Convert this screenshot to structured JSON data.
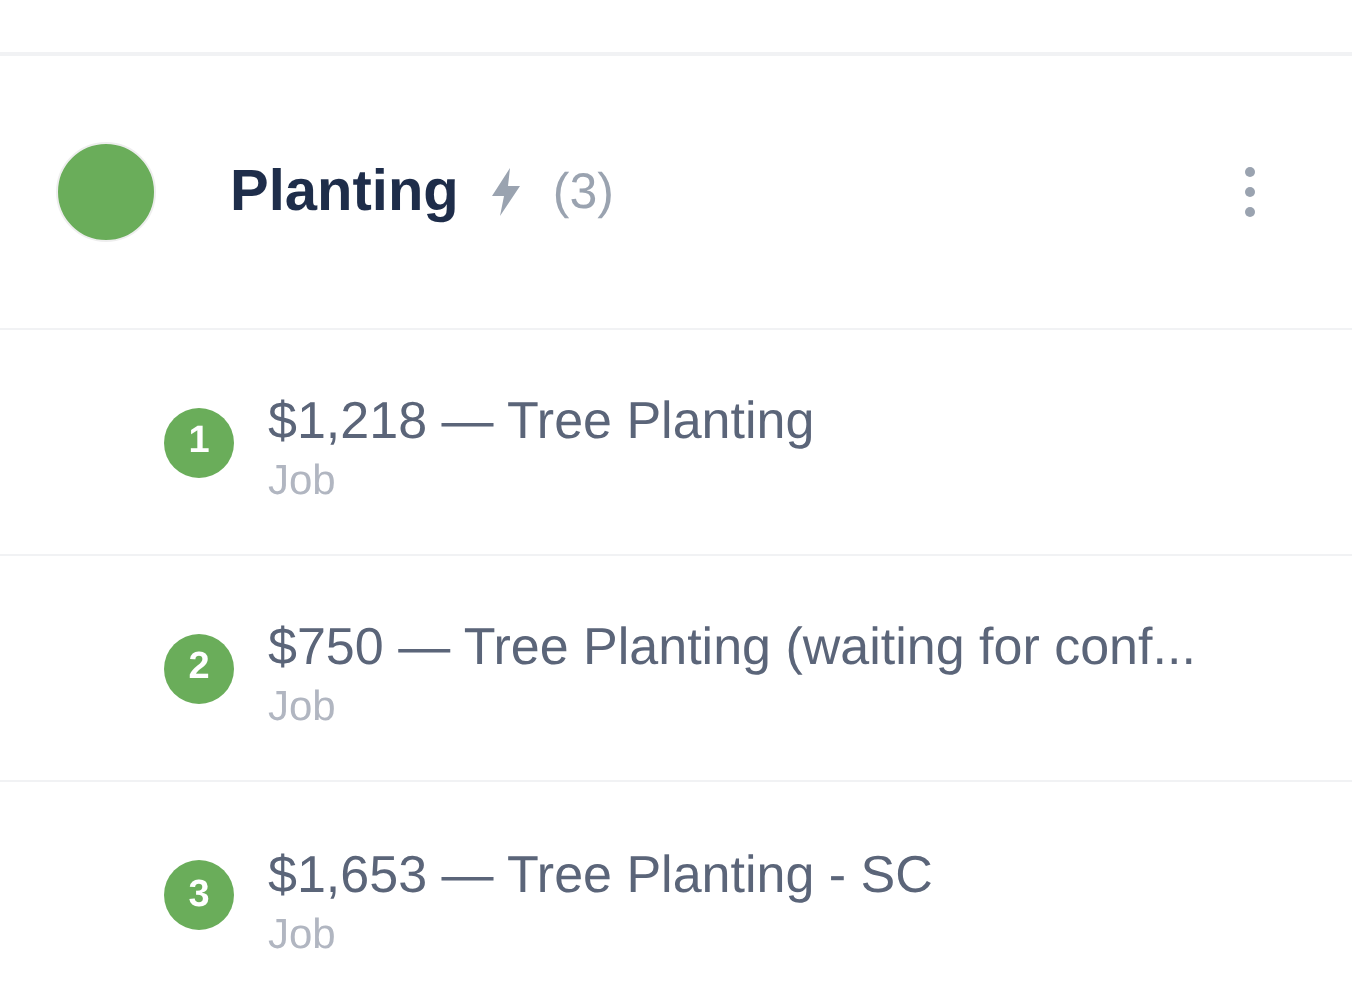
{
  "stage": {
    "title": "Planting",
    "color": "#6aad5a",
    "count": "(3)"
  },
  "items": [
    {
      "number": "1",
      "title": "$1,218 — Tree Planting",
      "type": "Job"
    },
    {
      "number": "2",
      "title": "$750 — Tree Planting (waiting for conf...",
      "type": "Job"
    },
    {
      "number": "3",
      "title": "$1,653 — Tree Planting - SC",
      "type": "Job"
    }
  ]
}
